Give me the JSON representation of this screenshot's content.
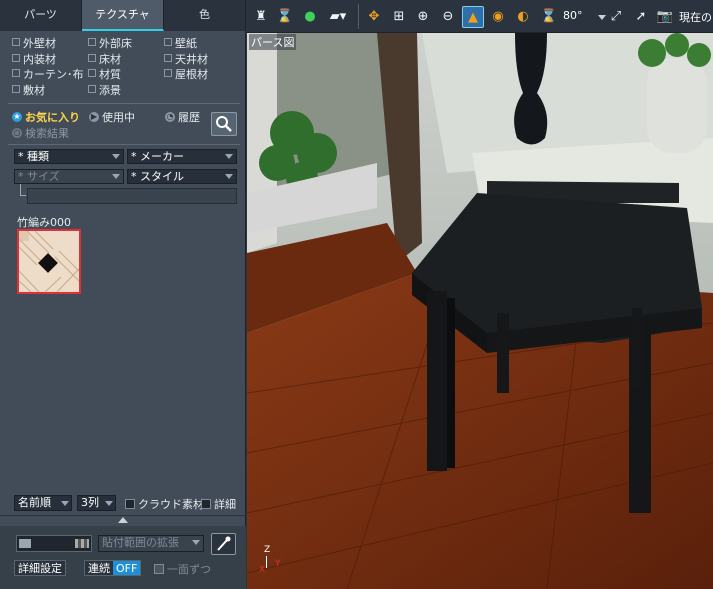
{
  "panel": {
    "tabs": [
      "パーツ",
      "テクスチャ",
      "色"
    ],
    "active_tab": "テクスチャ",
    "categories": [
      [
        "外壁材",
        "外部床",
        "壁紙"
      ],
      [
        "内装材",
        "床材",
        "天井材"
      ],
      [
        "カーテン･布",
        "材質",
        "屋根材"
      ],
      [
        "敷材",
        "添景",
        ""
      ]
    ],
    "filters": {
      "favorites": "お気に入り",
      "in_use": "使用中",
      "history": "履歴",
      "search_results": "検索結果"
    },
    "selects": {
      "type": "* 種類",
      "maker": "* メーカー",
      "size": "* サイズ",
      "style": "* スタイル"
    },
    "thumbnail": {
      "title": "竹編み000"
    },
    "sort": "名前順",
    "columns": "3列",
    "cloud_material": "クラウド素材",
    "detail_check": "詳細",
    "texture_range": "貼付範囲の拡張",
    "detail_settings": "詳細設定",
    "continuous": "連続",
    "continuous_state": "OFF",
    "one_side": "一面ずつ"
  },
  "toolbar": {
    "fov": "80°",
    "current": "現在の"
  },
  "viewport": {
    "label": "パース図",
    "axes": {
      "z": "Z",
      "x": "X",
      "y": "Y"
    }
  }
}
